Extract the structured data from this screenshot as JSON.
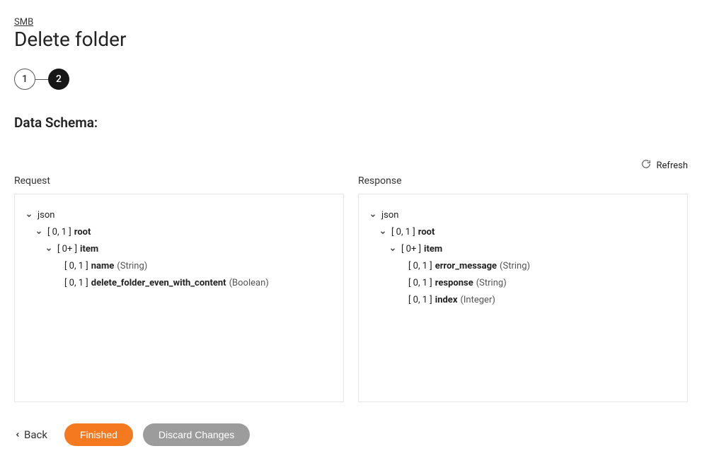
{
  "breadcrumb": "SMB",
  "page_title": "Delete folder",
  "stepper": {
    "step1": "1",
    "step2": "2"
  },
  "section_title": "Data Schema:",
  "refresh_label": "Refresh",
  "panels": {
    "request": {
      "label": "Request",
      "rows": [
        {
          "indent": 0,
          "chev": true,
          "card": "",
          "name": "json",
          "type": "",
          "bold": false
        },
        {
          "indent": 1,
          "chev": true,
          "card": "[ 0, 1 ]",
          "name": "root",
          "type": "",
          "bold": true
        },
        {
          "indent": 2,
          "chev": true,
          "card": "[ 0+ ]",
          "name": "item",
          "type": "",
          "bold": true
        },
        {
          "indent": 3,
          "chev": false,
          "card": "[ 0, 1 ]",
          "name": "name",
          "type": "(String)",
          "bold": true
        },
        {
          "indent": 3,
          "chev": false,
          "card": "[ 0, 1 ]",
          "name": "delete_folder_even_with_content",
          "type": "(Boolean)",
          "bold": true
        }
      ]
    },
    "response": {
      "label": "Response",
      "rows": [
        {
          "indent": 0,
          "chev": true,
          "card": "",
          "name": "json",
          "type": "",
          "bold": false
        },
        {
          "indent": 1,
          "chev": true,
          "card": "[ 0, 1 ]",
          "name": "root",
          "type": "",
          "bold": true
        },
        {
          "indent": 2,
          "chev": true,
          "card": "[ 0+ ]",
          "name": "item",
          "type": "",
          "bold": true
        },
        {
          "indent": 3,
          "chev": false,
          "card": "[ 0, 1 ]",
          "name": "error_message",
          "type": "(String)",
          "bold": true
        },
        {
          "indent": 3,
          "chev": false,
          "card": "[ 0, 1 ]",
          "name": "response",
          "type": "(String)",
          "bold": true
        },
        {
          "indent": 3,
          "chev": false,
          "card": "[ 0, 1 ]",
          "name": "index",
          "type": "(Integer)",
          "bold": true
        }
      ]
    }
  },
  "footer": {
    "back": "Back",
    "finished": "Finished",
    "discard": "Discard Changes"
  }
}
